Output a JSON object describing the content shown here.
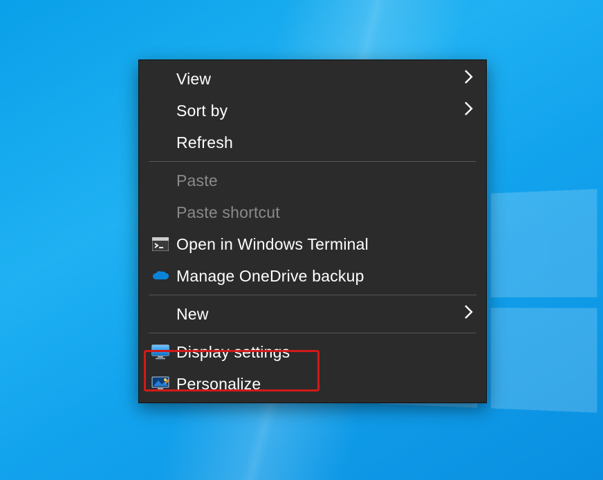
{
  "context_menu": {
    "view": {
      "label": "View",
      "submenu": true
    },
    "sort_by": {
      "label": "Sort by",
      "submenu": true
    },
    "refresh": {
      "label": "Refresh",
      "submenu": false
    },
    "paste": {
      "label": "Paste",
      "enabled": false
    },
    "paste_shortcut": {
      "label": "Paste shortcut",
      "enabled": false
    },
    "open_terminal": {
      "label": "Open in Windows Terminal"
    },
    "manage_onedrive": {
      "label": "Manage OneDrive backup"
    },
    "new": {
      "label": "New",
      "submenu": true
    },
    "display_settings": {
      "label": "Display settings"
    },
    "personalize": {
      "label": "Personalize"
    }
  },
  "highlighted_item": "display_settings",
  "colors": {
    "menu_bg": "#2b2b2b",
    "menu_text": "#ffffff",
    "menu_disabled": "#8a8a8a",
    "separator": "#555555",
    "highlight_border": "#d21a1a",
    "desktop_accent": "#13a4ee"
  }
}
